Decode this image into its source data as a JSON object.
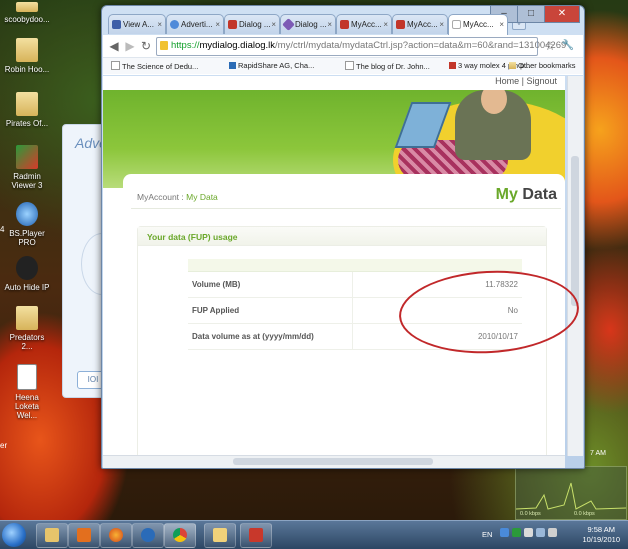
{
  "desktop": {
    "icons": [
      {
        "label": "scoobydoo...",
        "kind": "folder"
      },
      {
        "label": "Robin Hoo...",
        "kind": "folder"
      },
      {
        "label": "Pirates Of...",
        "kind": "folder"
      },
      {
        "label": "Radmin Viewer 3",
        "kind": "app"
      },
      {
        "label": "BS.Player PRO",
        "kind": "app"
      },
      {
        "label": "Auto Hide IP",
        "kind": "app"
      },
      {
        "label": "Predators 2...",
        "kind": "folder"
      },
      {
        "label": "Heena Loketa Wel...",
        "kind": "file"
      }
    ],
    "bg_window_title": "Adve",
    "bg_window_button": "IOI",
    "edge_labels": [
      "4",
      "er"
    ]
  },
  "browser": {
    "tabs": [
      {
        "title": "View A...",
        "favicon_color": "#3d5ea8"
      },
      {
        "title": "Adverti...",
        "favicon_color": "#4f8ad9"
      },
      {
        "title": "Dialog ...",
        "favicon_color": "#c2362a"
      },
      {
        "title": "Dialog ...",
        "favicon_color": "#7d5bb5"
      },
      {
        "title": "MyAcc...",
        "favicon_color": "#c2362a"
      },
      {
        "title": "MyAcc...",
        "favicon_color": "#c2362a"
      },
      {
        "title": "MyAcc...",
        "favicon_color": "#c2362a"
      }
    ],
    "active_tab_index": 6,
    "url": {
      "scheme": "https://",
      "host": "mydialog.dialog.lk",
      "path": "/my/ctrl/mydata/mydataCtrl.jsp?action=data&m=60&rand=131004269"
    },
    "bookmarks": [
      "The Science of Dedu...",
      "RapidShare AG, Cha...",
      "The blog of Dr. John...",
      "3 way molex 4 pin p..."
    ],
    "other_bookmarks": "Other bookmarks",
    "icons": {
      "back": "◀",
      "forward": "▶",
      "reload": "↻",
      "star": "☆",
      "wrench": "🔧",
      "tab_close": "×",
      "new_tab": "+"
    }
  },
  "page": {
    "top_links": {
      "home": "Home",
      "separator": "|",
      "signout": "Signout"
    },
    "breadcrumb": {
      "root": "MyAccount",
      "separator": " : ",
      "current": "My Data"
    },
    "title": {
      "prefix": "My",
      "suffix": " Data"
    },
    "section_title": "Your data (FUP) usage",
    "rows": [
      {
        "label": "Volume (MB)",
        "value": "11.78322"
      },
      {
        "label": "FUP Applied",
        "value": "No"
      },
      {
        "label": "Data volume as at (yyyy/mm/dd)",
        "value": "2010/10/17"
      }
    ],
    "annotation_color": "#c1282a",
    "accent_color": "#6aa82a"
  },
  "taskbar": {
    "language": "EN",
    "time": "9:58 AM",
    "date": "10/19/2010",
    "gadget_labels": [
      "0.0 kbps",
      "0.0 kbps"
    ],
    "side_clock_label": "7 AM"
  }
}
